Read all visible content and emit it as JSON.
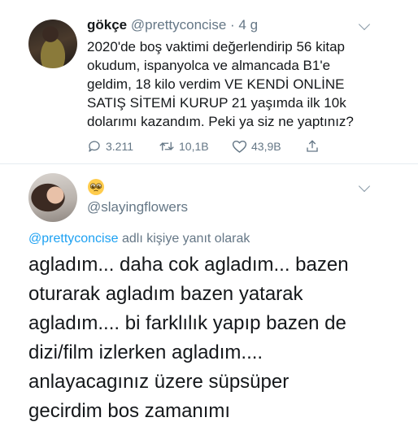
{
  "tweet": {
    "display_name": "gökçe",
    "handle": "@prettyconcise",
    "time": "· 4 g",
    "lines": [
      "2020'de boş vaktimi değerlendirip 56 kitap",
      "okudum, ispanyolca ve almancada B1'e",
      "geldim, 18 kilo verdim VE KENDİ ONLİNE",
      "SATIŞ SİTEMİ KURUP 21 yaşımda ilk 10k",
      "dolarımı kazandım. Peki ya siz ne yaptınız?"
    ],
    "replies": "3.211",
    "retweets": "10,1B",
    "likes": "43,9B"
  },
  "reply": {
    "handle": "@slayingflowers",
    "replying_to_handle": "@prettyconcise",
    "replying_to_suffix": " adlı kişiye yanıt olarak",
    "lines": [
      "agladım... daha cok agladım... bazen",
      "oturarak agladım bazen yatarak",
      "agladım.... bi farklılık yapıp bazen de",
      "dizi/film izlerken agladım....",
      "anlayacagınız üzere süpsüper",
      "gecirdim bos zamanımı"
    ]
  },
  "icons": {
    "reply": "speech-bubble-icon",
    "retweet": "retweet-icon",
    "like": "heart-icon",
    "share": "share-icon",
    "menu": "chevron-down-icon",
    "emoji": "pleading-face-emoji"
  },
  "colors": {
    "link": "#1da1f2",
    "secondary_text": "#657786",
    "divider": "#e6ecf0"
  }
}
